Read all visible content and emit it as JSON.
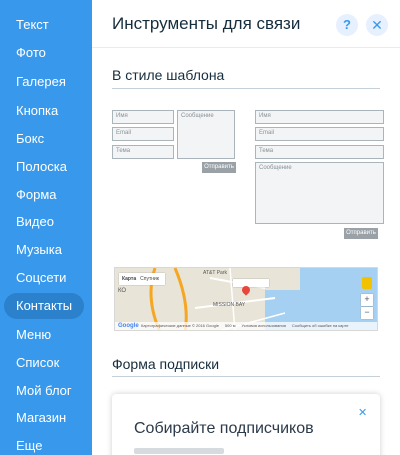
{
  "sidebar": {
    "items": [
      {
        "label": "Текст"
      },
      {
        "label": "Фото"
      },
      {
        "label": "Галерея"
      },
      {
        "label": "Кнопка"
      },
      {
        "label": "Бокс"
      },
      {
        "label": "Полоска"
      },
      {
        "label": "Форма"
      },
      {
        "label": "Видео"
      },
      {
        "label": "Музыка"
      },
      {
        "label": "Соцсети"
      },
      {
        "label": "Контакты",
        "active": true
      },
      {
        "label": "Меню"
      },
      {
        "label": "Список"
      },
      {
        "label": "Мой блог"
      },
      {
        "label": "Магазин"
      },
      {
        "label": "Еще"
      }
    ]
  },
  "panel": {
    "title": "Инструменты для связи",
    "help_label": "?",
    "close_label": "✕",
    "section_template": "В стиле шаблона",
    "section_subscribe": "Форма подписки"
  },
  "form1": {
    "name": "Имя",
    "email": "Email",
    "subject": "Тема",
    "message": "Сообщение",
    "send": "Отправить"
  },
  "form2": {
    "name": "Имя",
    "email": "Email",
    "subject": "Тема",
    "message": "Сообщение",
    "send": "Отправить"
  },
  "map": {
    "tab_map": "Карта",
    "tab_satellite": "Спутник",
    "label_att": "AT&T Park",
    "label_mission": "MISSION BAY",
    "label_ko": "КО",
    "zoom_in": "+",
    "zoom_out": "−",
    "logo": "Google",
    "footer_data": "Картографические данные © 2016 Google",
    "footer_scale": "500 м",
    "footer_terms": "Условия использования",
    "footer_report": "Сообщить об ошибке на карте"
  },
  "subscribe_card": {
    "title": "Собирайте подписчиков",
    "close_label": "✕"
  },
  "colors": {
    "sidebar": "#3899ec",
    "sidebar_active": "#2b81cb",
    "accent": "#3899ec",
    "title_text": "#162d3d"
  }
}
